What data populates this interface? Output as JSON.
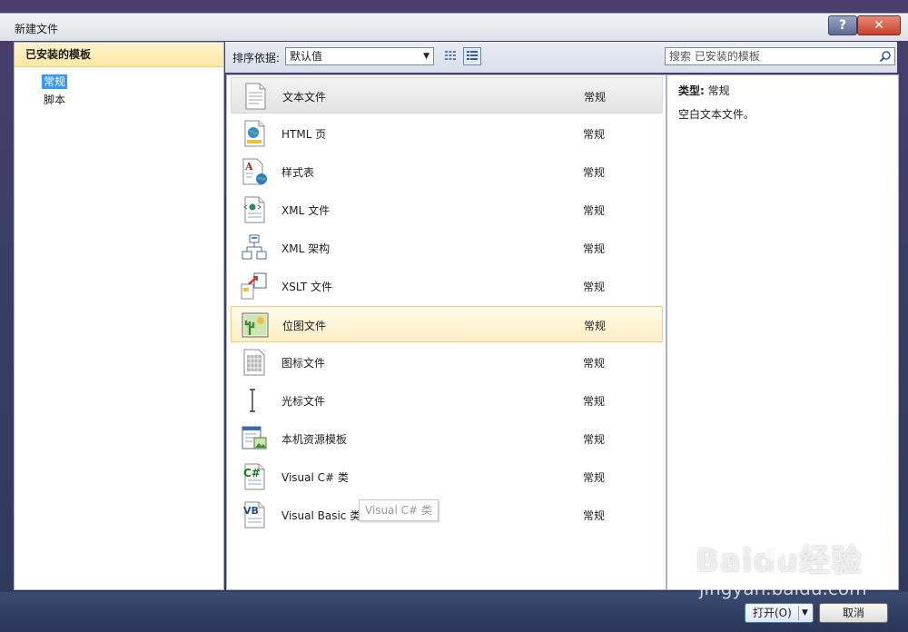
{
  "window": {
    "title": "新建文件",
    "help_label": "?",
    "close_label": "✕"
  },
  "left": {
    "header": "已安装的模板",
    "items": [
      {
        "label": "常规",
        "selected": true
      },
      {
        "label": "脚本",
        "selected": false
      }
    ]
  },
  "toolbar": {
    "sort_label": "排序依据:",
    "sort_value": "默认值",
    "search_placeholder": "搜索 已安装的模板"
  },
  "templates": [
    {
      "name": "文本文件",
      "category": "常规",
      "icon": "text-file-icon",
      "state": "hover"
    },
    {
      "name": "HTML 页",
      "category": "常规",
      "icon": "html-page-icon"
    },
    {
      "name": "样式表",
      "category": "常规",
      "icon": "stylesheet-icon"
    },
    {
      "name": "XML 文件",
      "category": "常规",
      "icon": "xml-file-icon"
    },
    {
      "name": "XML 架构",
      "category": "常规",
      "icon": "xml-schema-icon"
    },
    {
      "name": "XSLT 文件",
      "category": "常规",
      "icon": "xslt-file-icon"
    },
    {
      "name": "位图文件",
      "category": "常规",
      "icon": "bitmap-file-icon",
      "state": "selected"
    },
    {
      "name": "图标文件",
      "category": "常规",
      "icon": "icon-file-icon"
    },
    {
      "name": "光标文件",
      "category": "常规",
      "icon": "cursor-file-icon"
    },
    {
      "name": "本机资源模板",
      "category": "常规",
      "icon": "resource-template-icon"
    },
    {
      "name": "Visual C# 类",
      "category": "常规",
      "icon": "csharp-class-icon"
    },
    {
      "name": "Visual Basic 类",
      "category": "常规",
      "icon": "vb-class-icon"
    }
  ],
  "tooltip": "Visual C# 类",
  "detail": {
    "type_label": "类型:",
    "type_value": "常规",
    "description": "空白文本文件。"
  },
  "buttons": {
    "open": "打开(O)",
    "cancel": "取消"
  },
  "watermark": {
    "logo": "Baidu经验",
    "url": "jingyan.baidu.com"
  },
  "colors": {
    "accent": "#3399ff",
    "selected_row": "#fdeec4",
    "frame": "#2f3a5c"
  }
}
